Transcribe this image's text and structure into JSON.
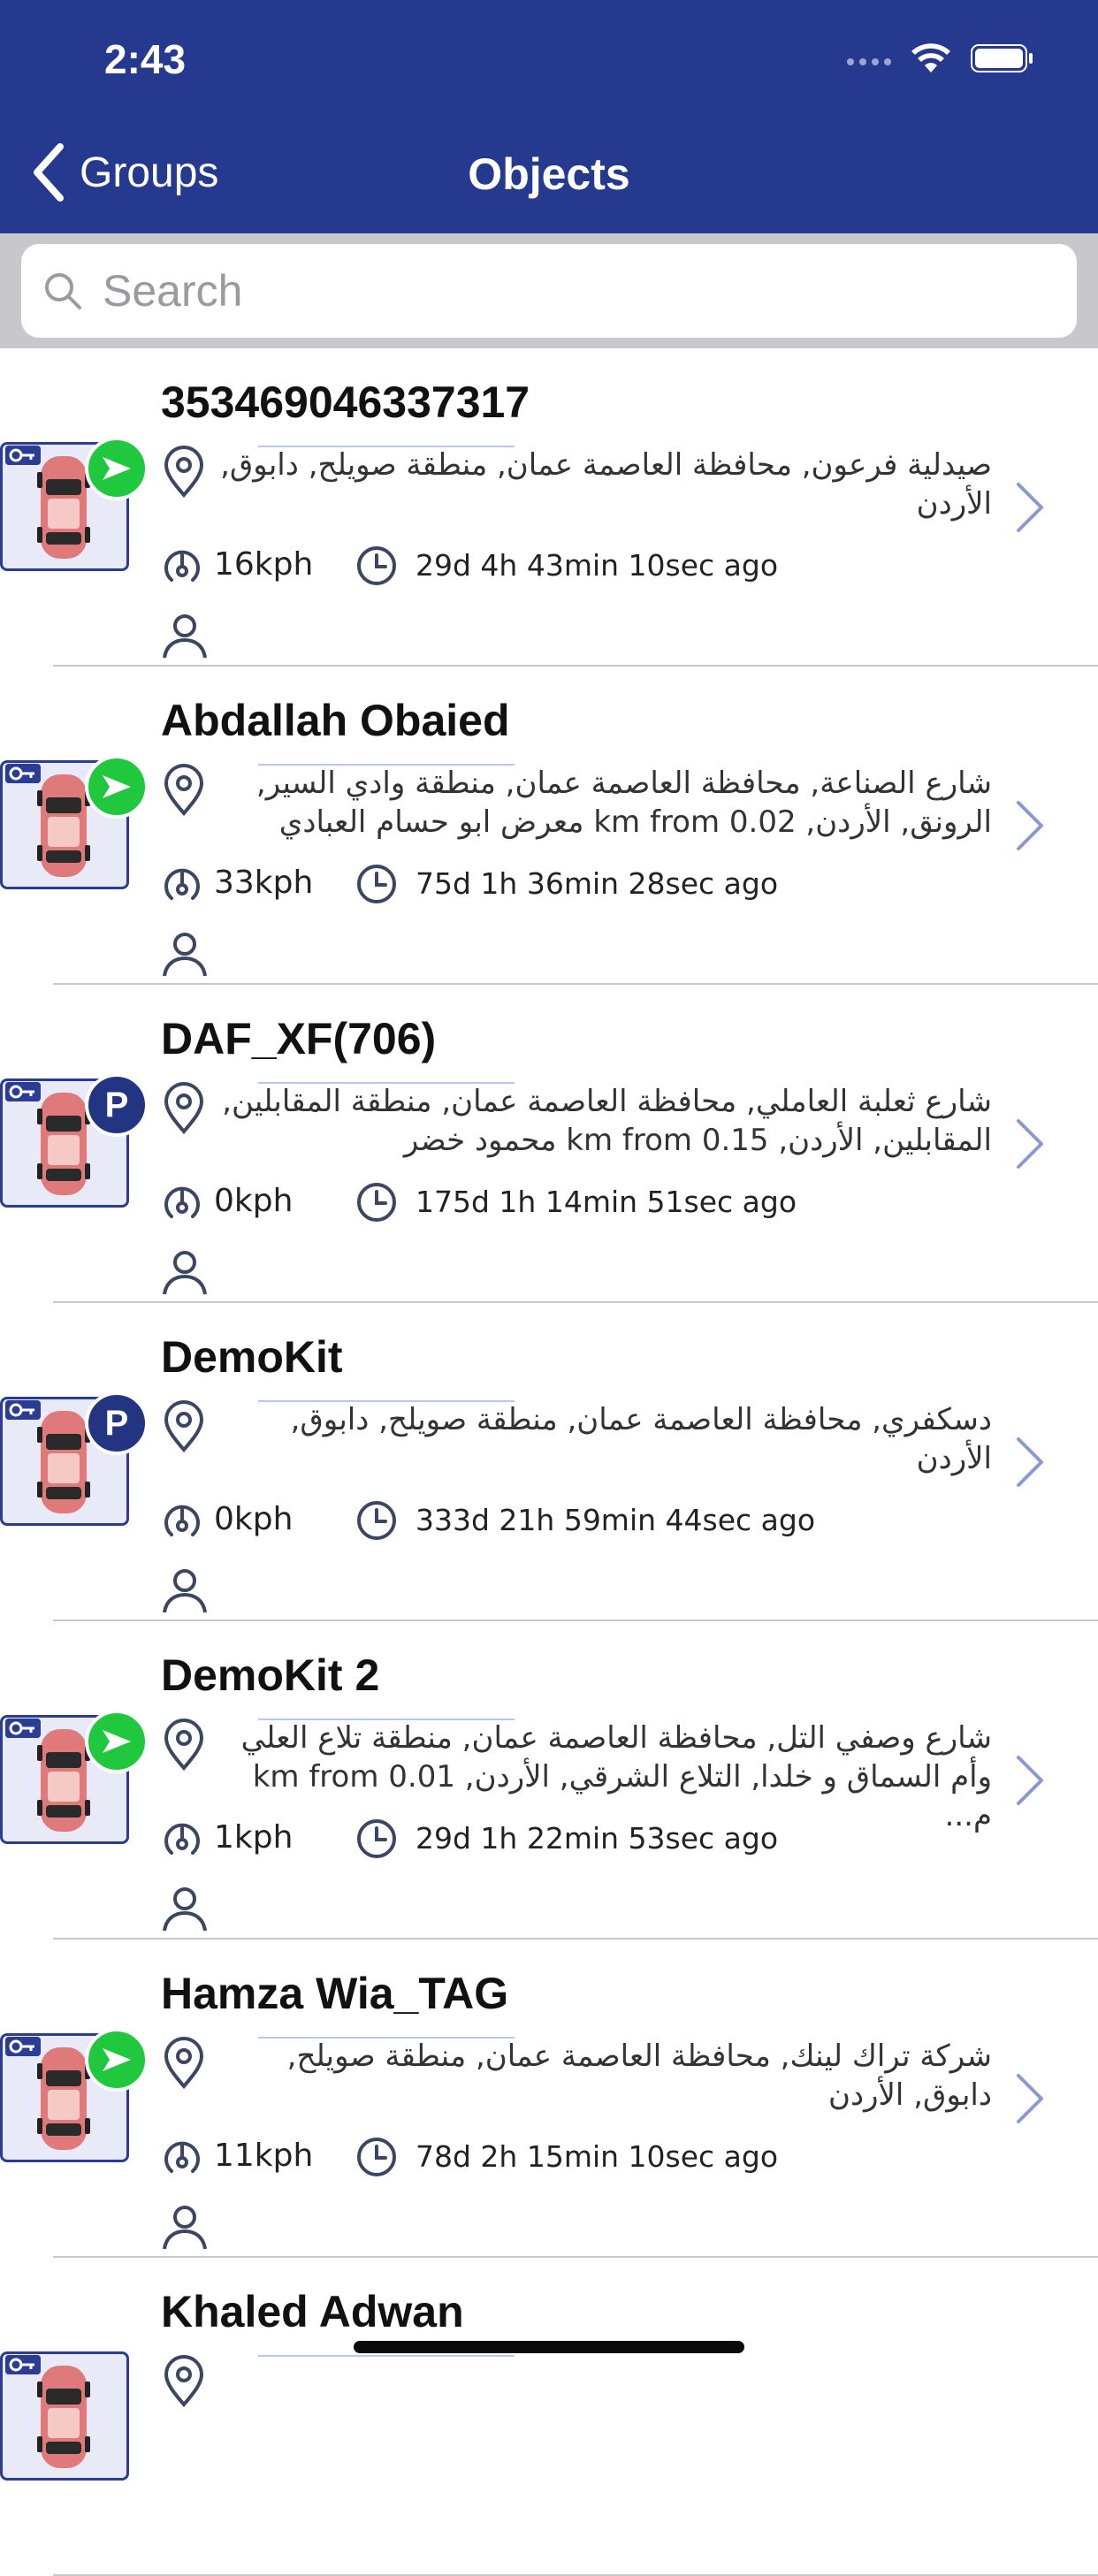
{
  "status_bar": {
    "time": "2:43"
  },
  "nav": {
    "back_label": "Groups",
    "title": "Objects"
  },
  "search": {
    "placeholder": "Search"
  },
  "colors": {
    "header": "#253a8e",
    "moving": "#1fc83d",
    "parked": "#233582"
  },
  "objects": [
    {
      "name": "353469046337317",
      "address": "صيدلية فرعون, محافظة العاصمة عمان, منطقة صويلح, دابوق, الأردن",
      "speed": "16kph",
      "ago": "29d 4h 43min 10sec ago",
      "status": "moving",
      "status_icon": "arrow-icon"
    },
    {
      "name": "Abdallah Obaied",
      "address": "شارع الصناعة, محافظة العاصمة عمان, منطقة وادي السير, الرونق, الأردن, 0.02 km from معرض ابو حسام العبادي",
      "speed": "33kph",
      "ago": "75d 1h 36min 28sec ago",
      "status": "moving",
      "status_icon": "arrow-icon"
    },
    {
      "name": "DAF_XF(706)",
      "address": "شارع ثعلبة العاملي, محافظة العاصمة عمان, منطقة المقابلين, المقابلين, الأردن, 0.15 km from محمود خضر",
      "speed": "0kph",
      "ago": "175d 1h 14min 51sec ago",
      "status": "parked",
      "status_label": "P"
    },
    {
      "name": "DemoKit",
      "address": "دسكفري, محافظة العاصمة عمان, منطقة صويلح, دابوق, الأردن",
      "speed": "0kph",
      "ago": "333d 21h 59min 44sec ago",
      "status": "parked",
      "status_label": "P"
    },
    {
      "name": "DemoKit 2",
      "address": "شارع وصفي التل, محافظة العاصمة عمان, منطقة تلاع العلي وأم السماق و خلدا, التلاع الشرقي, الأردن, 0.01 km from م...",
      "speed": "1kph",
      "ago": "29d 1h 22min 53sec ago",
      "status": "moving",
      "status_icon": "arrow-icon"
    },
    {
      "name": "Hamza Wia_TAG",
      "address": "شركة تراك لينك, محافظة العاصمة عمان, منطقة صويلح, دابوق, الأردن",
      "speed": "11kph",
      "ago": "78d 2h 15min 10sec ago",
      "status": "moving",
      "status_icon": "arrow-icon"
    },
    {
      "name": "Khaled Adwan",
      "address": "",
      "speed": "",
      "ago": "",
      "status": ""
    }
  ]
}
